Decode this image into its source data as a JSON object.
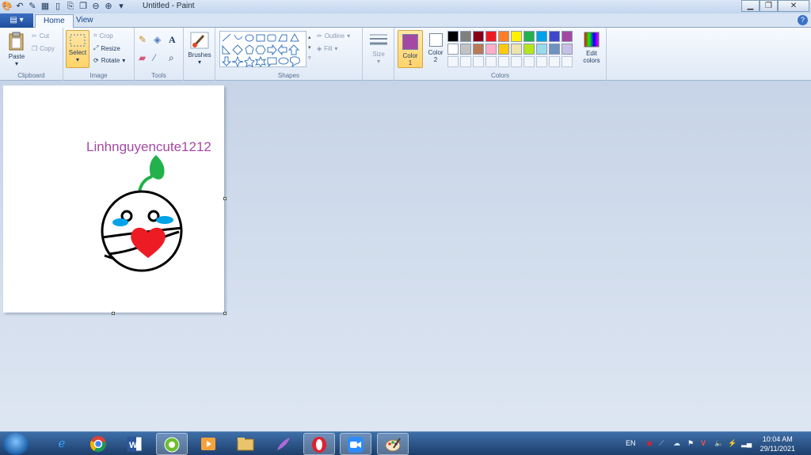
{
  "window": {
    "title": "Untitled - Paint"
  },
  "tabs": [
    {
      "label": "Home"
    },
    {
      "label": "View"
    }
  ],
  "ribbon": {
    "clipboard": {
      "group_label": "Clipboard",
      "paste": "Paste",
      "cut": "Cut",
      "copy": "Copy"
    },
    "image": {
      "group_label": "Image",
      "select": "Select",
      "crop": "Crop",
      "resize": "Resize",
      "rotate": "Rotate"
    },
    "tools": {
      "group_label": "Tools"
    },
    "brushes": {
      "label": "Brushes"
    },
    "shapes": {
      "group_label": "Shapes",
      "outline": "Outline",
      "fill": "Fill"
    },
    "size": {
      "label": "Size"
    },
    "colors": {
      "group_label": "Colors",
      "color1_label": "Color 1",
      "color2_label": "Color 2",
      "color1": "#a349a4",
      "color2": "#ffffff",
      "edit_colors": "Edit colors",
      "palette_row1": [
        "#000000",
        "#7f7f7f",
        "#880015",
        "#ed1c24",
        "#ff7f27",
        "#fff200",
        "#22b14c",
        "#00a2e8",
        "#3f48cc",
        "#a349a4"
      ],
      "palette_row2": [
        "#ffffff",
        "#c3c3c3",
        "#b97a57",
        "#ffaec9",
        "#ffc90e",
        "#efe4b0",
        "#b5e61d",
        "#99d9ea",
        "#7092be",
        "#c8bfe7"
      ]
    }
  },
  "canvas": {
    "text": "Linhnguyencute1212",
    "text_color": "#a349a4",
    "stem_color": "#22b14c",
    "tear_color": "#00a2e8",
    "heart_color": "#ed1c24"
  },
  "taskbar": {
    "apps": [
      "internet-explorer",
      "chrome",
      "word",
      "greenshot",
      "media-player",
      "file-explorer",
      "feather-app",
      "opera",
      "zoom",
      "paint"
    ],
    "language": "EN",
    "time": "10:04 AM",
    "date": "29/11/2021"
  }
}
